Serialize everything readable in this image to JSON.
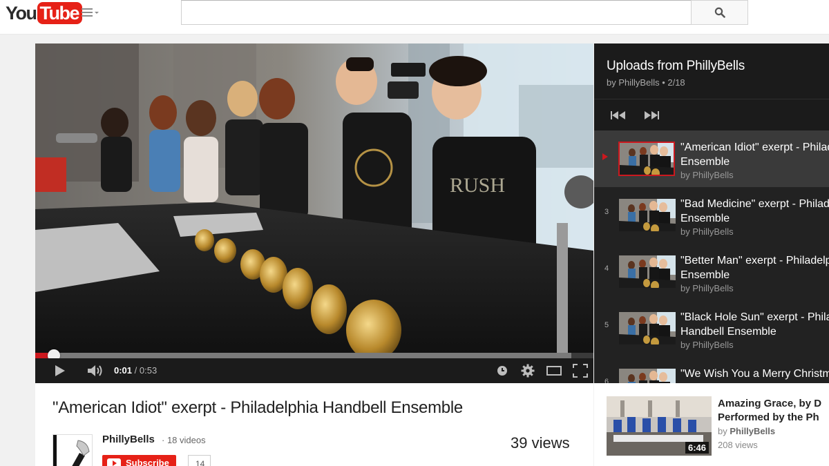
{
  "masthead": {
    "logo_you": "You",
    "logo_tube": "Tube",
    "search_value": "",
    "search_placeholder": ""
  },
  "player": {
    "time_current": "0:01",
    "time_separator": " / ",
    "time_total": "0:53",
    "progress_played_fraction": 0.033,
    "progress_buffered_fraction": 0.96
  },
  "playlist": {
    "title": "Uploads from PhillyBells",
    "subtitle": "by PhillyBells • 2/18",
    "items": [
      {
        "index": "",
        "active": true,
        "title_line1": "\"American Idiot\" exerpt - Philadelphia",
        "title_line2": "Ensemble",
        "by": "by PhillyBells"
      },
      {
        "index": "3",
        "active": false,
        "title_line1": "\"Bad Medicine\" exerpt - Philadelphia",
        "title_line2": "Ensemble",
        "by": "by PhillyBells"
      },
      {
        "index": "4",
        "active": false,
        "title_line1": "\"Better Man\" exerpt - Philadelphia",
        "title_line2": "Ensemble",
        "by": "by PhillyBells"
      },
      {
        "index": "5",
        "active": false,
        "title_line1": "\"Black Hole Sun\" exerpt - Philadelphia",
        "title_line2": "Handbell Ensemble",
        "by": "by PhillyBells"
      },
      {
        "index": "6",
        "active": false,
        "title_line1": "\"We Wish You a Merry Christmas\"",
        "title_line2": "",
        "by": ""
      }
    ]
  },
  "watch": {
    "title": "\"American Idiot\" exerpt - Philadelphia Handbell Ensemble",
    "owner_name": "PhillyBells",
    "owner_videos": "· 18 videos",
    "subscribe_label": "Subscribe",
    "subscriber_count": "14",
    "views": "39 views"
  },
  "related": {
    "title_line1": "Amazing Grace, by D",
    "title_line2": "Performed by the Ph",
    "by_prefix": "by ",
    "by_name": "PhillyBells",
    "views": "208 views",
    "duration": "6:46"
  },
  "icons": {
    "search": "search-icon",
    "play": "play-icon",
    "volume": "volume-icon",
    "watch_later": "clock-icon",
    "settings": "gear-icon",
    "size": "theater-mode-icon",
    "fullscreen": "fullscreen-icon",
    "prev": "previous-icon",
    "next": "next-icon"
  },
  "colors": {
    "brand_red": "#e62117",
    "progress_red": "#cc181e",
    "panel_dark": "#222222"
  }
}
